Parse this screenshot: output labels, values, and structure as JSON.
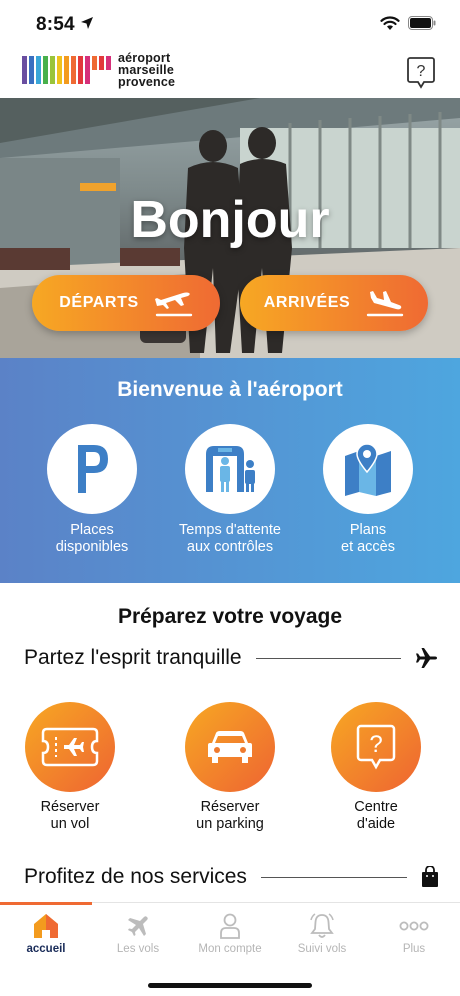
{
  "status_bar": {
    "time": "8:54"
  },
  "header": {
    "logo_lines": [
      "aéroport",
      "marseille",
      "provence"
    ],
    "help_icon": "question-bubble-icon"
  },
  "hero": {
    "greeting": "Bonjour",
    "departures_label": "DÉPARTS",
    "arrivals_label": "ARRIVÉES"
  },
  "welcome": {
    "title": "Bienvenue à l'aéroport",
    "items": [
      {
        "label": "Places\ndisponibles",
        "icon": "parking-icon"
      },
      {
        "label": "Temps d'attente\naux contrôles",
        "icon": "security-gate-icon"
      },
      {
        "label": "Plans\net accès",
        "icon": "map-pin-icon"
      }
    ]
  },
  "prepare": {
    "title": "Préparez votre voyage",
    "subtitle": "Partez l'esprit tranquille",
    "actions": [
      {
        "label": "Réserver\nun vol",
        "icon": "ticket-plane-icon"
      },
      {
        "label": "Réserver\nun parking",
        "icon": "car-icon"
      },
      {
        "label": "Centre\nd'aide",
        "icon": "help-icon"
      }
    ],
    "services_title": "Profitez de nos services"
  },
  "tabbar": {
    "active": "accueil",
    "tabs": [
      {
        "label": "accueil",
        "icon": "home-icon"
      },
      {
        "label": "Les vols",
        "icon": "plane-icon"
      },
      {
        "label": "Mon compte",
        "icon": "user-icon"
      },
      {
        "label": "Suivi vols",
        "icon": "bell-icon"
      },
      {
        "label": "Plus",
        "icon": "more-icon"
      }
    ]
  },
  "colors": {
    "orange_start": "#f7a823",
    "orange_end": "#ef6a33",
    "blue_start": "#5b82c7",
    "blue_end": "#4ea6df",
    "navy": "#1a2c59"
  }
}
